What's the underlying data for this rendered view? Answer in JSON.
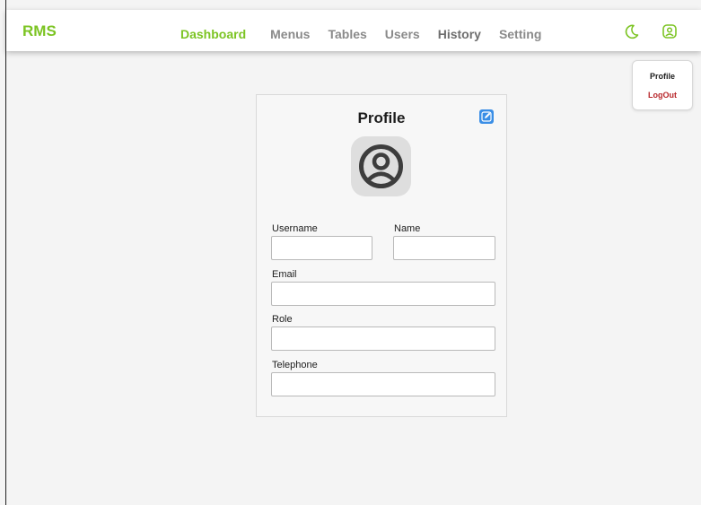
{
  "brand": "RMS",
  "nav": {
    "items": [
      {
        "label": "Dashboard"
      },
      {
        "label": "Menus"
      },
      {
        "label": "Tables"
      },
      {
        "label": "Users"
      },
      {
        "label": "History"
      },
      {
        "label": "Setting"
      }
    ],
    "active": "Dashboard"
  },
  "header_icons": [
    "moon-icon",
    "user-circle-icon"
  ],
  "dropdown": {
    "profile": "Profile",
    "logout": "LogOut"
  },
  "profile": {
    "title": "Profile",
    "edit_icon": "edit-icon",
    "avatar_icon": "user-circle-icon",
    "fields": {
      "username": {
        "label": "Username",
        "value": ""
      },
      "name": {
        "label": "Name",
        "value": ""
      },
      "email": {
        "label": "Email",
        "value": ""
      },
      "role": {
        "label": "Role",
        "value": ""
      },
      "telephone": {
        "label": "Telephone",
        "value": ""
      }
    }
  },
  "colors": {
    "accent": "#7cc423",
    "nav_inactive": "#8a8a8a",
    "logout": "#b8262a",
    "edit": "#3a8ee6",
    "background": "#f4f4f4"
  }
}
